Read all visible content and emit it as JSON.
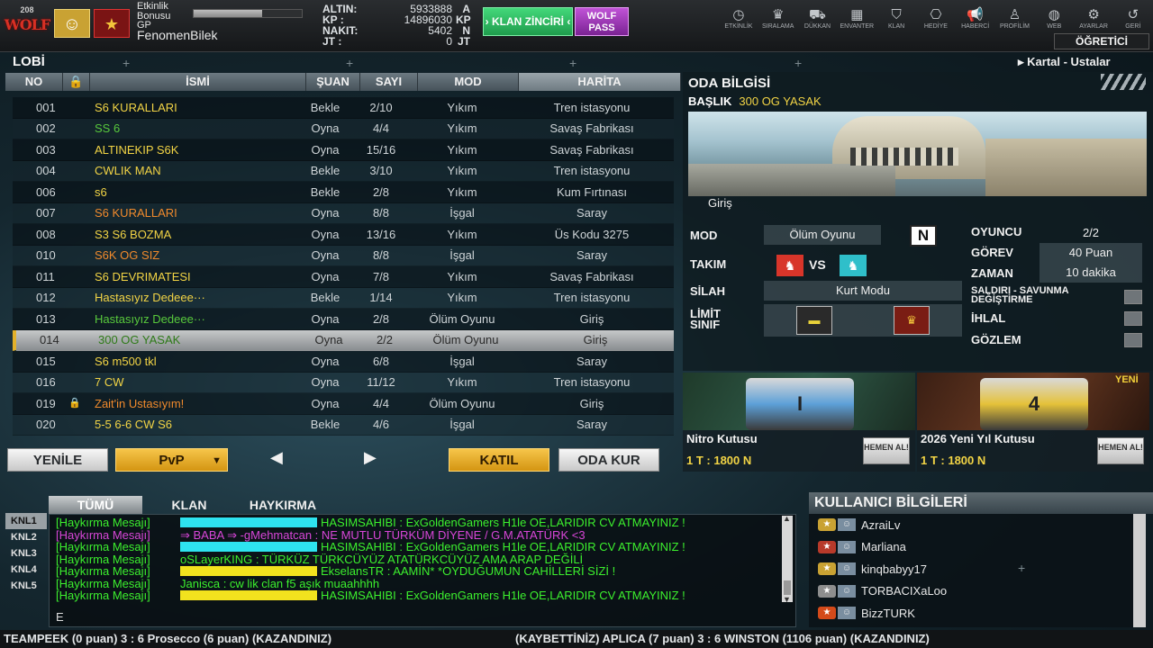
{
  "player": {
    "level": "208",
    "clan_logo_text": "WOLF",
    "nickname": "FenomenBilek",
    "bonus_label": "Etkinlik Bonusu",
    "gp_label": "GP",
    "gp_progress": 0.63
  },
  "currency": [
    {
      "label": "ALTIN:",
      "value": "5933888",
      "unit": "A"
    },
    {
      "label": "KP :",
      "value": "14896030",
      "unit": "KP"
    },
    {
      "label": "NAKIT:",
      "value": "5402",
      "unit": "N"
    },
    {
      "label": "JT :",
      "value": "0",
      "unit": "JT"
    }
  ],
  "klan_button": "› KLAN ZİNCİRİ ‹",
  "wolf_pass": "WOLF PASS",
  "menu": [
    {
      "icon": "clock-icon",
      "glyph": "◷",
      "label": "ETKİNLİK"
    },
    {
      "icon": "ranking-icon",
      "glyph": "♛",
      "label": "SIRALAMA"
    },
    {
      "icon": "cart-icon",
      "glyph": "⛟",
      "label": "DÜKKAN"
    },
    {
      "icon": "inventory-icon",
      "glyph": "▦",
      "label": "ENVANTER"
    },
    {
      "icon": "clan-icon",
      "glyph": "⛉",
      "label": "KLAN"
    },
    {
      "icon": "gift-icon",
      "glyph": "⎔",
      "label": "HEDİYE"
    },
    {
      "icon": "megaphone-icon",
      "glyph": "📢",
      "label": "HABERCİ"
    },
    {
      "icon": "profile-icon",
      "glyph": "♙",
      "label": "PROFİLİM"
    },
    {
      "icon": "web-icon",
      "glyph": "◍",
      "label": "WEB"
    },
    {
      "icon": "settings-icon",
      "glyph": "⚙",
      "label": "AYARLAR"
    },
    {
      "icon": "back-icon",
      "glyph": "↺",
      "label": "GERİ"
    }
  ],
  "ogretici": "ÖĞRETİCİ",
  "lobby": {
    "title": "LOBİ",
    "channel": "Kartal - Ustalar",
    "columns": {
      "no": "NO",
      "name": "İSMİ",
      "status": "ŞUAN",
      "count": "SAYI",
      "mode": "MOD",
      "map": "HARİTA"
    },
    "rooms": [
      {
        "no": "001",
        "name": "S6 KURALLARI",
        "color": "#f2d445",
        "status": "Bekle",
        "count": "2/10",
        "mode": "Yıkım",
        "map": "Tren istasyonu"
      },
      {
        "no": "002",
        "name": "SS 6",
        "color": "#58c93c",
        "status": "Oyna",
        "count": "4/4",
        "mode": "Yıkım",
        "map": "Savaş Fabrikası"
      },
      {
        "no": "003",
        "name": "ALTINEKIP S6K",
        "color": "#f2d445",
        "status": "Oyna",
        "count": "15/16",
        "mode": "Yıkım",
        "map": "Savaş Fabrikası"
      },
      {
        "no": "004",
        "name": "CWLIK MAN",
        "color": "#f2d445",
        "status": "Bekle",
        "count": "3/10",
        "mode": "Yıkım",
        "map": "Tren istasyonu"
      },
      {
        "no": "006",
        "name": "s6",
        "color": "#f2d445",
        "status": "Bekle",
        "count": "2/8",
        "mode": "Yıkım",
        "map": "Kum Fırtınası"
      },
      {
        "no": "007",
        "name": "S6 KURALLARI",
        "color": "#f08a2c",
        "status": "Oyna",
        "count": "8/8",
        "mode": "İşgal",
        "map": "Saray"
      },
      {
        "no": "008",
        "name": "S3 S6 BOZMA",
        "color": "#f2d445",
        "status": "Oyna",
        "count": "13/16",
        "mode": "Yıkım",
        "map": "Üs Kodu 3275"
      },
      {
        "no": "010",
        "name": "S6K OG SIZ",
        "color": "#f08a2c",
        "status": "Oyna",
        "count": "8/8",
        "mode": "İşgal",
        "map": "Saray"
      },
      {
        "no": "011",
        "name": "S6 DEVRIMATESI",
        "color": "#f2d445",
        "status": "Oyna",
        "count": "7/8",
        "mode": "Yıkım",
        "map": "Savaş Fabrikası"
      },
      {
        "no": "012",
        "name": "Hastasıyız Dedeee···",
        "color": "#f2d445",
        "status": "Bekle",
        "count": "1/14",
        "mode": "Yıkım",
        "map": "Tren istasyonu"
      },
      {
        "no": "013",
        "name": "Hastasıyız Dedeee···",
        "color": "#58c93c",
        "status": "Oyna",
        "count": "2/8",
        "mode": "Ölüm Oyunu",
        "map": "Giriş"
      },
      {
        "no": "014",
        "name": "300 OG YASAK",
        "color": "#2e7a18",
        "status": "Oyna",
        "count": "2/2",
        "mode": "Ölüm Oyunu",
        "map": "Giriş",
        "selected": true
      },
      {
        "no": "015",
        "name": "S6 m500 tkl",
        "color": "#f2d445",
        "status": "Oyna",
        "count": "6/8",
        "mode": "İşgal",
        "map": "Saray"
      },
      {
        "no": "016",
        "name": "7 CW",
        "color": "#f2d445",
        "status": "Oyna",
        "count": "11/12",
        "mode": "Yıkım",
        "map": "Tren istasyonu"
      },
      {
        "no": "019",
        "name": "Zait'in Ustasıyım!",
        "color": "#f08a2c",
        "status": "Oyna",
        "count": "4/4",
        "mode": "Ölüm Oyunu",
        "map": "Giriş",
        "locked": true
      },
      {
        "no": "020",
        "name": "5-5 6-6 CW S6",
        "color": "#f2d445",
        "status": "Bekle",
        "count": "4/6",
        "mode": "İşgal",
        "map": "Saray"
      }
    ],
    "buttons": {
      "refresh": "YENİLE",
      "pvp": "PvP",
      "join": "KATIL",
      "create": "ODA KUR"
    }
  },
  "room": {
    "title": "ODA BİLGİSİ",
    "baslik_label": "BAŞLIK",
    "baslik": "300 OG YASAK",
    "map": "Giriş",
    "mod_label": "MOD",
    "mod": "Ölüm Oyunu",
    "mod_tag": "N",
    "takim_label": "TAKIM",
    "vs": "VS",
    "silah_label": "SİLAH",
    "silah": "Kurt Modu",
    "limit_label": "LİMİT SINIF",
    "oyuncu_label": "OYUNCU",
    "oyuncu": "2/2",
    "gorev_label": "GÖREV",
    "gorev": "40 Puan",
    "zaman_label": "ZAMAN",
    "zaman": "10 dakika",
    "saldiri_label": "SALDIRI - SAVUNMA DEĞİŞTİRME",
    "ihlal_label": "İHLAL",
    "gozlem_label": "GÖZLEM"
  },
  "shop": [
    {
      "name": "Nitro Kutusu",
      "price": "1 T : 1800 N",
      "buy": "HEMEN AL!",
      "chest_color": "#5da0d8",
      "chest_text": "I"
    },
    {
      "name": "2026 Yeni Yıl Kutusu",
      "price": "1 T : 1800 N",
      "buy": "HEMEN AL!",
      "badge": "YENİ",
      "chest_color": "#e5c23a",
      "chest_text": "4"
    }
  ],
  "chat": {
    "tabs": [
      "TÜMÜ",
      "KLAN",
      "HAYKIRMA"
    ],
    "channels": [
      "KNL1",
      "KNL2",
      "KNL3",
      "KNL4",
      "KNL5"
    ],
    "messages": [
      {
        "source": "[Haykırma Mesajı]",
        "bar": "#2ee3f0",
        "text": "HASIMSAHIBI : ExGoldenGamers H1le OE,LARIDIR CV ATMAYINIZ !",
        "color": "#3cf02e"
      },
      {
        "source": "[Haykırma Mesajı]",
        "bar": "",
        "text": "⇒ BABA ⇒ -gMehmatcan :          NE MUTLU TÜRKÜM DİYENE / G.M.ATATÜRK <3",
        "color": "#d846d8"
      },
      {
        "source": "[Haykırma Mesajı]",
        "bar": "#2ee3f0",
        "text": "HASIMSAHIBI : ExGoldenGamers H1le OE,LARIDIR CV ATMAYINIZ !",
        "color": "#3cf02e"
      },
      {
        "source": "[Haykırma Mesajı]",
        "bar": "",
        "text": "oSLayerKING : TÜRKÜZ TÜRKCÜYÜZ ATATÜRKCÜYÜZ AMA ARAP DEĞİLİ",
        "color": "#3cf02e"
      },
      {
        "source": "[Haykırma Mesajı]",
        "bar": "#f2e21e",
        "text": "EkselansTR : AAMİN* *OYDUĞUMUN CAHİLLERİ SİZİ !",
        "color": "#3cf02e"
      },
      {
        "source": "[Haykırma Mesajı]",
        "bar": "",
        "text": "Janisca : cw lik clan f5 aşık muaahhhh",
        "color": "#3cf02e"
      },
      {
        "source": "[Haykırma Mesajı]",
        "bar": "#f2e21e",
        "text": "HASIMSAHIBI : ExGoldenGamers H1le OE,LARIDIR CV ATMAYINIZ !",
        "color": "#3cf02e"
      }
    ],
    "input": "E"
  },
  "users": {
    "title": "KULLANICI BİLGİLERİ",
    "list": [
      {
        "name": "AzraiLv",
        "rank_color": "#c9a233"
      },
      {
        "name": "Marliana",
        "rank_color": "#b83a2a"
      },
      {
        "name": "kinqbabyy17",
        "rank_color": "#c9a233"
      },
      {
        "name": "TORBACIXaLoo",
        "rank_color": "#8e8e8e"
      },
      {
        "name": "BizzTURK",
        "rank_color": "#d44a1a"
      }
    ]
  },
  "ticker": {
    "left": "TEAMPEEK (0 puan) 3 : 6 Prosecco (6 puan) (KAZANDINIZ)",
    "right": "(KAYBETTİNİZ) APLICA (7 puan) 3 : 6 WINSTON (1106 puan) (KAZANDINIZ)"
  }
}
